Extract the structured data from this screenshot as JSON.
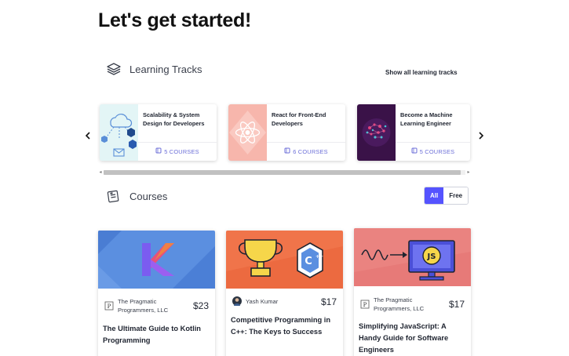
{
  "page": {
    "title": "Let's get started!"
  },
  "tracks": {
    "heading": "Learning Tracks",
    "icon": "layers-icon",
    "show_all_label": "Show all learning tracks",
    "items": [
      {
        "title": "Scalability & System Design for Developers",
        "count": "5 COURSES",
        "thumb": "cloud-network-icon"
      },
      {
        "title": "React for Front-End Developers",
        "count": "6 COURSES",
        "thumb": "react-atom-icon"
      },
      {
        "title": "Become a Machine Learning Engineer",
        "count": "5 COURSES",
        "thumb": "brain-icon"
      }
    ]
  },
  "courses": {
    "heading": "Courses",
    "icon": "course-document-icon",
    "filters": {
      "all_label": "All",
      "free_label": "Free",
      "selected": "All"
    },
    "items": [
      {
        "author": "The Pragmatic Programmers, LLC",
        "price": "$23",
        "title": "The Ultimate Guide to Kotlin Programming",
        "banner": "kotlin-logo"
      },
      {
        "author": "Yash Kumar",
        "price": "$17",
        "title": "Competitive Programming in C++: The Keys to Success",
        "banner": "trophy-cpp-logo"
      },
      {
        "author": "The Pragmatic Programmers, LLC",
        "price": "$17",
        "title": "Simplifying JavaScript: A Handy Guide for Software Engineers",
        "banner": "js-monitor"
      }
    ]
  },
  "colors": {
    "accent": "#5553ff",
    "course_count": "#6c6fd8",
    "kotlin_banner": "#5b8fe0",
    "cpp_banner": "#f0744a",
    "js_banner": "#e77a78"
  }
}
